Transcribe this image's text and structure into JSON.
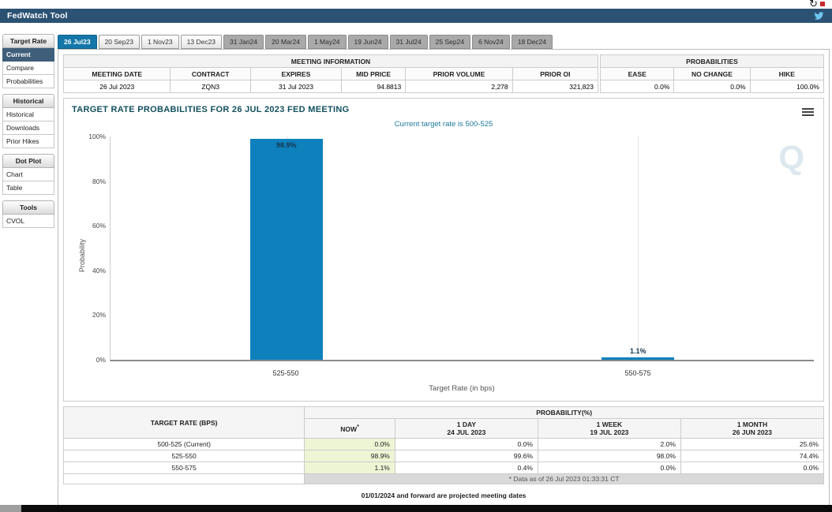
{
  "titlebar": {
    "title": "FedWatch Tool"
  },
  "top_icons": {
    "refresh": "↻"
  },
  "sidebar": {
    "sections": [
      {
        "header": "Target Rate",
        "items": [
          {
            "label": "Current",
            "selected": true
          },
          {
            "label": "Compare"
          },
          {
            "label": "Probabilities"
          }
        ]
      },
      {
        "header": "Historical",
        "items": [
          {
            "label": "Historical"
          },
          {
            "label": "Downloads"
          },
          {
            "label": "Prior Hikes"
          }
        ]
      },
      {
        "header": "Dot Plot",
        "items": [
          {
            "label": "Chart"
          },
          {
            "label": "Table"
          }
        ]
      },
      {
        "header": "Tools",
        "items": [
          {
            "label": "CVOL"
          }
        ]
      }
    ]
  },
  "tabs": [
    "26 Jul23",
    "20 Sep23",
    "1 Nov23",
    "13 Dec23",
    "31 Jan24",
    "20 Mar24",
    "1 May24",
    "19 Jun24",
    "31 Jul24",
    "25 Sep24",
    "6 Nov24",
    "18 Dec24"
  ],
  "meeting_info": {
    "title": "MEETING INFORMATION",
    "headers": [
      "MEETING DATE",
      "CONTRACT",
      "EXPIRES",
      "MID PRICE",
      "PRIOR VOLUME",
      "PRIOR OI"
    ],
    "values": [
      "26 Jul 2023",
      "ZQN3",
      "31 Jul 2023",
      "94.8813",
      "2,278",
      "321,823"
    ]
  },
  "probabilities_panel": {
    "title": "PROBABILITIES",
    "headers": [
      "EASE",
      "NO CHANGE",
      "HIKE"
    ],
    "values": [
      "0.0%",
      "0.0%",
      "100.0%"
    ]
  },
  "chart_data": {
    "type": "bar",
    "title": "TARGET RATE PROBABILITIES FOR 26 JUL 2023 FED MEETING",
    "subtitle": "Current target rate is 500-525",
    "categories": [
      "525-550",
      "550-575"
    ],
    "values": [
      98.9,
      1.1
    ],
    "bar_labels": [
      "98.9%",
      "1.1%"
    ],
    "xlabel": "Target Rate (in bps)",
    "ylabel": "Probability",
    "ylim": [
      0,
      100
    ],
    "yticks": [
      "0%",
      "20%",
      "40%",
      "60%",
      "80%",
      "100%"
    ],
    "bar_color": "#0e81bd",
    "grid": "vertical-category-lines",
    "legend": "none",
    "watermark": "Q"
  },
  "rate_table": {
    "corner_header": "TARGET RATE (BPS)",
    "group_header": "PROBABILITY(%)",
    "columns": [
      {
        "line1": "NOW",
        "sup": "*"
      },
      {
        "line1": "1 DAY",
        "line2": "24 JUL 2023"
      },
      {
        "line1": "1 WEEK",
        "line2": "19 JUL 2023"
      },
      {
        "line1": "1 MONTH",
        "line2": "26 JUN 2023"
      }
    ],
    "rows": [
      {
        "rate": "500-525 (Current)",
        "values": [
          "0.0%",
          "0.0%",
          "2.0%",
          "25.6%"
        ]
      },
      {
        "rate": "525-550",
        "values": [
          "98.9%",
          "99.6%",
          "98.0%",
          "74.4%"
        ]
      },
      {
        "rate": "550-575",
        "values": [
          "1.1%",
          "0.4%",
          "0.0%",
          "0.0%"
        ]
      }
    ],
    "footnote": "* Data as of 26 Jul 2023 01:33:31 CT",
    "now_highlight_color": "#eef5d5"
  },
  "footer_note": "01/01/2024 and forward are projected meeting dates"
}
